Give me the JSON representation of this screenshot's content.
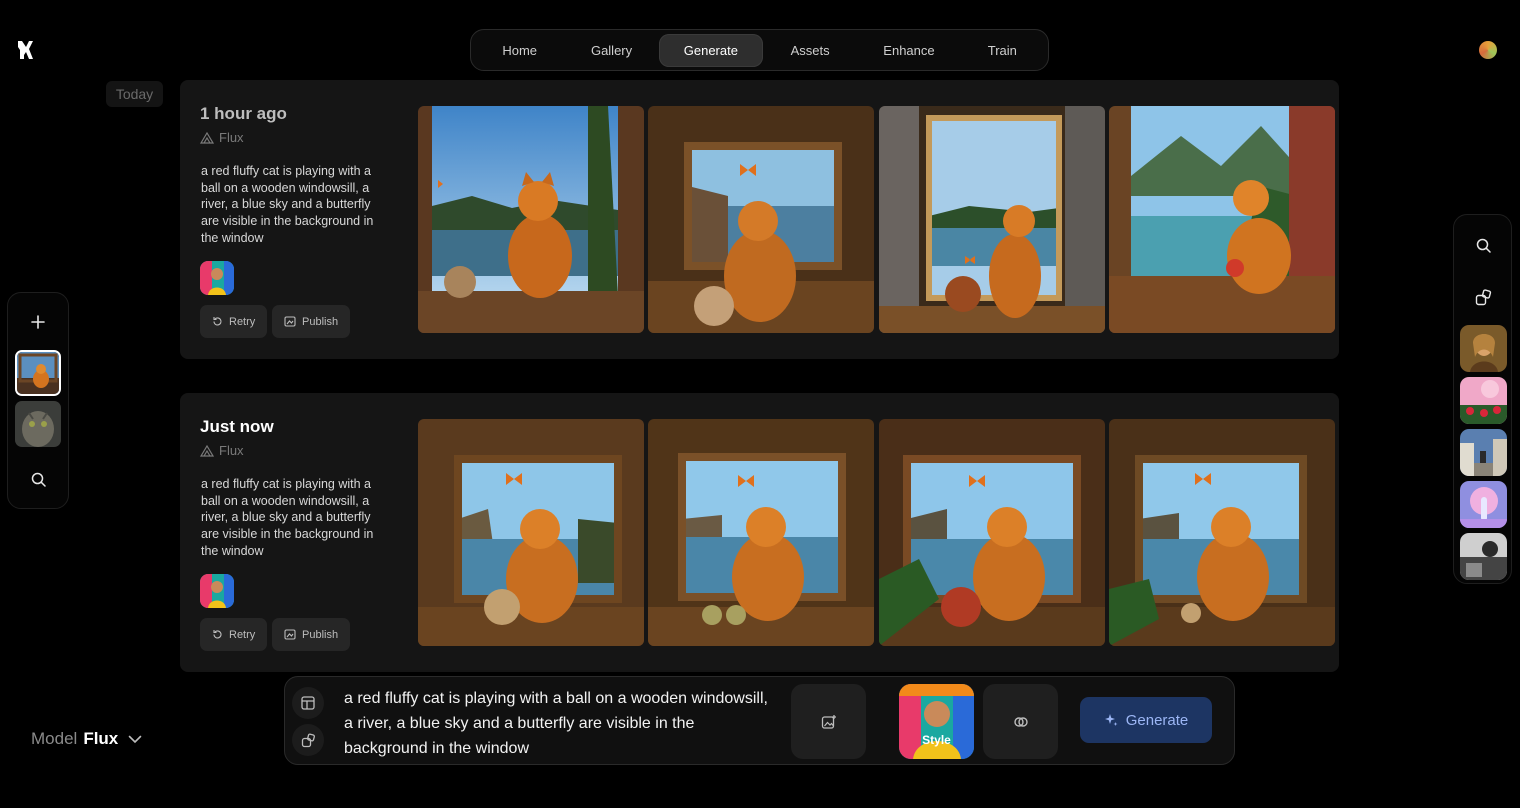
{
  "nav": {
    "tabs": [
      {
        "label": "Home"
      },
      {
        "label": "Gallery"
      },
      {
        "label": "Generate"
      },
      {
        "label": "Assets"
      },
      {
        "label": "Enhance"
      },
      {
        "label": "Train"
      }
    ],
    "active": "Generate"
  },
  "day_label": "Today",
  "generations": [
    {
      "time": "1 hour ago",
      "model": "Flux",
      "prompt": "a red fluffy cat is playing with a ball on a wooden windowsill, a river, a blue sky and a butterfly are visible in the background in the window",
      "retry_label": "Retry",
      "publish_label": "Publish"
    },
    {
      "time": "Just now",
      "model": "Flux",
      "prompt": "a red fluffy cat is playing with a ball on a wooden windowsill, a river, a blue sky and a butterfly are visible in the background in the window",
      "retry_label": "Retry",
      "publish_label": "Publish"
    }
  ],
  "prompt_bar": {
    "text": "a red fluffy cat is playing with a ball on a wooden windowsill, a river, a blue sky and a butterfly are visible in the background in the window",
    "style_label": "Style",
    "generate_label": "Generate"
  },
  "model_selector": {
    "label": "Model",
    "value": "Flux"
  },
  "colors": {
    "accent": "#1d3563",
    "accent_text": "#9cb6f5",
    "card": "#151515",
    "background": "#000000"
  }
}
